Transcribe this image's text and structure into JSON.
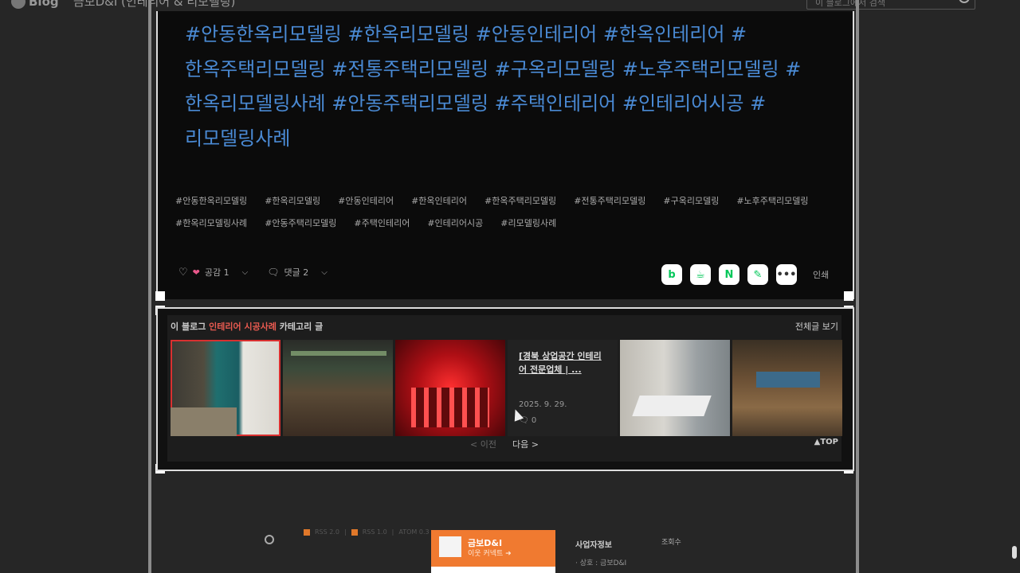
{
  "topbar": {
    "logo_text": "Blog",
    "blog_title": "금보D&I (인테리어 & 리모델링)",
    "search_placeholder": "이 블로그에서 검색"
  },
  "post": {
    "hashtag_paragraph": "#안동한옥리모델링 #한옥리모델링 #안동인테리어 #한옥인테리어 #한옥주택리모델링 #전통주택리모델링 #구옥리모델링 #노후주택리모델링 #한옥리모델링사례 #안동주택리모델링 #주택인테리어 #인테리어시공 #리모델링사례",
    "tags": [
      "#안동한옥리모델링",
      "#한옥리모델링",
      "#안동인테리어",
      "#한옥인테리어",
      "#한옥주택리모델링",
      "#전통주택리모델링",
      "#구옥리모델링",
      "#노후주택리모델링",
      "#한옥리모델링사례",
      "#안동주택리모델링",
      "#주택인테리어",
      "#인테리어시공",
      "#리모델링사례"
    ],
    "like_label": "공감 1",
    "comment_label": "댓글 2",
    "share_labels": [
      "b",
      "☕",
      "N",
      "✎",
      "•••"
    ],
    "print_label": "인쇄"
  },
  "category": {
    "prefix": "이 블로그",
    "name": "인테리어 시공사례",
    "suffix": "카테고리 글",
    "view_all": "전체글 보기",
    "card_title": "[경북 상업공간 인테리어 전문업체 | ...",
    "card_date": "2025. 9. 29.",
    "card_comments": "0",
    "prev_label": "< 이전",
    "next_label": "다음 >",
    "top_label": "▲TOP"
  },
  "footer": {
    "rss_labels": [
      "RSS 2.0",
      "RSS 1.0",
      "ATOM 0.3"
    ],
    "profile_name": "금보D&I",
    "profile_sub": "이웃 커넥트",
    "biz_title": "사업자정보",
    "biz_row": "· 상호 : 금보D&I",
    "views_label": "조회수"
  },
  "colors": {
    "hashtag": "#4a8ad4",
    "accent": "#e85a50",
    "profile_bg": "#f07a30"
  }
}
